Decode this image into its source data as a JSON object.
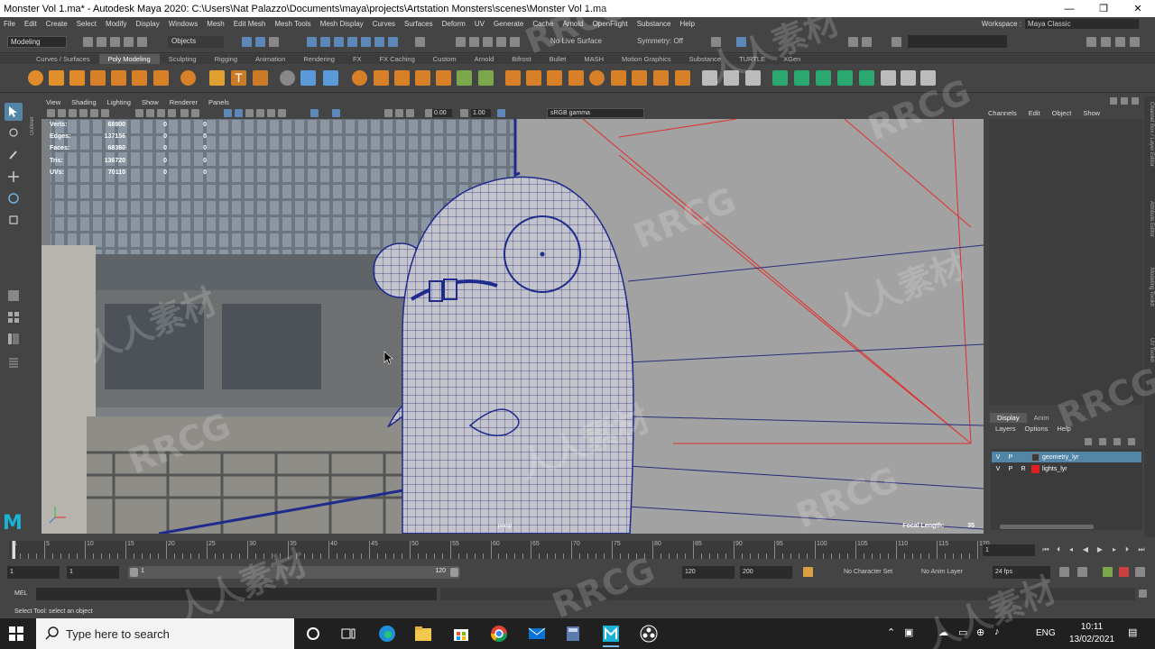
{
  "window": {
    "title": "Monster Vol 1.ma* - Autodesk Maya 2020: C:\\Users\\Nat Palazzo\\Documents\\maya\\projects\\Artstation Monsters\\scenes\\Monster Vol 1.ma",
    "controls": {
      "minimize": "—",
      "maximize": "❐",
      "close": "✕"
    }
  },
  "menubar": {
    "items": [
      "File",
      "Edit",
      "Create",
      "Select",
      "Modify",
      "Display",
      "Windows",
      "Mesh",
      "Edit Mesh",
      "Mesh Tools",
      "Mesh Display",
      "Curves",
      "Surfaces",
      "Deform",
      "UV",
      "Generate",
      "Cache",
      "Arnold",
      "OpenFlight",
      "Substance",
      "Help"
    ],
    "workspace_label": "Workspace :",
    "workspace_value": "Maya Classic"
  },
  "statusline": {
    "mode": "Modeling",
    "objects": "Objects",
    "live_surface": "No Live Surface",
    "symmetry": "Symmetry: Off"
  },
  "shelf": {
    "tabs": [
      "Curves / Surfaces",
      "Poly Modeling",
      "Sculpting",
      "Rigging",
      "Animation",
      "Rendering",
      "FX",
      "FX Caching",
      "Custom",
      "Arnold",
      "Bifrost",
      "Bullet",
      "MASH",
      "Motion Graphics",
      "Substance",
      "TURTLE",
      "XGen"
    ],
    "active_tab": "Poly Modeling"
  },
  "outliner_label": "Outliner",
  "panel": {
    "menu": [
      "View",
      "Shading",
      "Lighting",
      "Show",
      "Renderer",
      "Panels"
    ],
    "exposure": "0.00",
    "gamma": "1.00",
    "color_space": "sRGB gamma"
  },
  "hud": {
    "rows": [
      {
        "label": "Verts:",
        "v1": "68800",
        "v2": "0",
        "v3": "0"
      },
      {
        "label": "Edges:",
        "v1": "137156",
        "v2": "0",
        "v3": "0"
      },
      {
        "label": "Faces:",
        "v1": "68360",
        "v2": "0",
        "v3": "0"
      },
      {
        "label": "Tris:",
        "v1": "136720",
        "v2": "0",
        "v3": "0"
      },
      {
        "label": "UVs:",
        "v1": "70110",
        "v2": "0",
        "v3": "0"
      }
    ],
    "camera": "persp",
    "focal_label": "Focal Length:",
    "focal_value": "35"
  },
  "channelbox": {
    "menu": [
      "Channels",
      "Edit",
      "Object",
      "Show"
    ]
  },
  "layers": {
    "tabs": [
      "Display",
      "Anim"
    ],
    "menu": [
      "Layers",
      "Options",
      "Help"
    ],
    "rows": [
      {
        "v": "V",
        "p": "P",
        "r": "",
        "name": "geometry_lyr",
        "color": "#3b3b3b",
        "selected": true
      },
      {
        "v": "V",
        "p": "P",
        "r": "R",
        "name": "lights_lyr",
        "color": "#e02020",
        "selected": false
      }
    ]
  },
  "side_tabs": [
    "Channel Box / Layer Editor",
    "Attribute Editor",
    "Modeling Toolkit",
    "UV Toolkit"
  ],
  "timeline": {
    "ticks": [
      "1",
      "5",
      "10",
      "15",
      "20",
      "25",
      "30",
      "35",
      "40",
      "45",
      "50",
      "55",
      "60",
      "65",
      "70",
      "75",
      "80",
      "85",
      "90",
      "95",
      "100",
      "105",
      "110",
      "115",
      "120"
    ],
    "current_frame": "1"
  },
  "range": {
    "start": "1",
    "start_inner": "1",
    "slider_start": "1",
    "slider_end": "120",
    "end_inner": "120",
    "end": "200",
    "character_set": "No Character Set",
    "anim_layer": "No Anim Layer",
    "fps": "24 fps"
  },
  "command": {
    "label": "MEL",
    "help": "Select Tool: select an object"
  },
  "taskbar": {
    "search_placeholder": "Type here to search",
    "language": "ENG",
    "time": "10:11",
    "date": "13/02/2021"
  },
  "watermark_text": [
    "RRCG",
    "人人素材"
  ],
  "colors": {
    "maya_bg": "#444444",
    "selection_blue": "#5285a6",
    "wireframe_blue": "#1f2a8a",
    "camera_red": "#e03030"
  }
}
